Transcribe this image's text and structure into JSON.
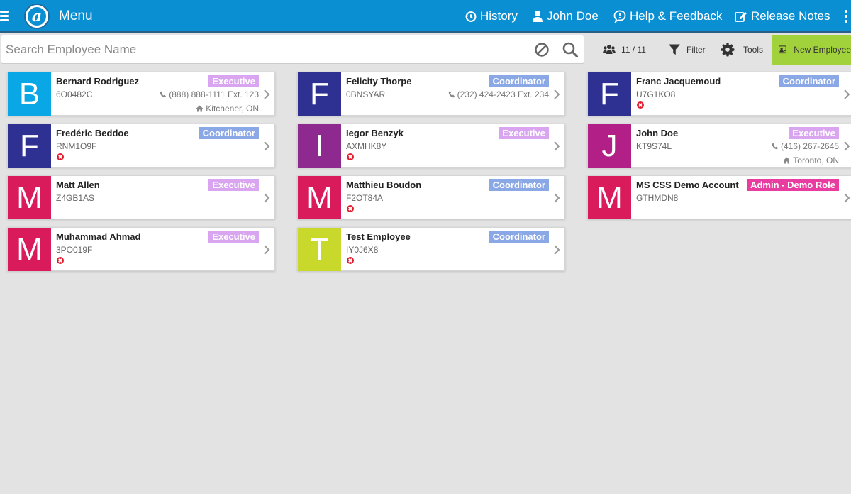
{
  "header": {
    "menu_title": "Menu",
    "nav": {
      "history": "History",
      "user": "John Doe",
      "help": "Help & Feedback",
      "release_notes": "Release Notes"
    }
  },
  "search": {
    "placeholder": "Search Employee Name",
    "value": ""
  },
  "toolbar": {
    "count": "11 / 11",
    "filter": "Filter",
    "tools": "Tools",
    "new_employee": "New Employee"
  },
  "colors": {
    "topbar": "#0b8fd3",
    "executive": "#d9a4f0",
    "coordinator": "#8aa7e6",
    "admin": "#e83ca0",
    "new_button": "#a2d23b"
  },
  "employees": [
    {
      "initial": "B",
      "name": "Bernard Rodriguez",
      "code": "6O0482C",
      "role": "Executive",
      "phone": "(888) 888-1111 Ext. 123",
      "location": "Kitchener, ON",
      "avatar_color": "#0aa7e6",
      "status": "none"
    },
    {
      "initial": "F",
      "name": "Felicity Thorpe",
      "code": "0BNSYAR",
      "role": "Coordinator",
      "phone": "(232) 424-2423 Ext. 234",
      "location": "",
      "avatar_color": "#2e3192",
      "status": "none"
    },
    {
      "initial": "F",
      "name": "Franc Jacquemoud",
      "code": "U7G1KO8",
      "role": "Coordinator",
      "phone": "",
      "location": "",
      "avatar_color": "#2e3192",
      "status": "inactive"
    },
    {
      "initial": "F",
      "name": "Fredéric Beddoe",
      "code": "RNM1O9F",
      "role": "Coordinator",
      "phone": "",
      "location": "",
      "avatar_color": "#2e3192",
      "status": "inactive"
    },
    {
      "initial": "I",
      "name": "Iegor Benzyk",
      "code": "AXMHK8Y",
      "role": "Executive",
      "phone": "",
      "location": "",
      "avatar_color": "#8e2a8f",
      "status": "inactive"
    },
    {
      "initial": "J",
      "name": "John Doe",
      "code": "KT9S74L",
      "role": "Executive",
      "phone": "(416) 267-2645",
      "location": "Toronto, ON",
      "avatar_color": "#b21f86",
      "status": "none"
    },
    {
      "initial": "M",
      "name": "Matt Allen",
      "code": "Z4GB1AS",
      "role": "Executive",
      "phone": "",
      "location": "",
      "avatar_color": "#d91b5c",
      "status": "none"
    },
    {
      "initial": "M",
      "name": "Matthieu Boudon",
      "code": "F2OT84A",
      "role": "Coordinator",
      "phone": "",
      "location": "",
      "avatar_color": "#d91b5c",
      "status": "inactive"
    },
    {
      "initial": "M",
      "name": "MS CSS Demo Account",
      "code": "GTHMDN8",
      "role": "Admin - Demo Role",
      "phone": "",
      "location": "",
      "avatar_color": "#d91b5c",
      "status": "none"
    },
    {
      "initial": "M",
      "name": "Muhammad Ahmad",
      "code": "3PO019F",
      "role": "Executive",
      "phone": "",
      "location": "",
      "avatar_color": "#d91b5c",
      "status": "inactive"
    },
    {
      "initial": "T",
      "name": "Test Employee",
      "code": "IY0J6X8",
      "role": "Coordinator",
      "phone": "",
      "location": "",
      "avatar_color": "#c8d92b",
      "status": "inactive"
    }
  ]
}
